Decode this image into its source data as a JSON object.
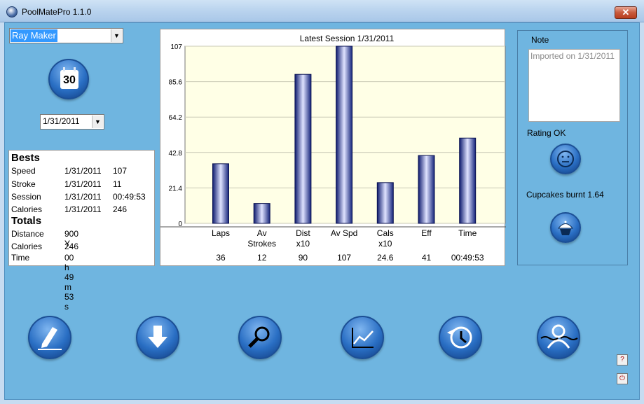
{
  "window": {
    "title": "PoolMatePro 1.1.0",
    "close_label": "✕"
  },
  "user": {
    "selected": "Ray Maker"
  },
  "calendar": {
    "day": "30"
  },
  "session_date": {
    "selected": "1/31/2011"
  },
  "bests": {
    "heading": "Bests",
    "rows": [
      {
        "label": "Speed",
        "date": "1/31/2011",
        "value": "107"
      },
      {
        "label": "Stroke",
        "date": "1/31/2011",
        "value": "11"
      },
      {
        "label": "Session",
        "date": "1/31/2011",
        "value": "00:49:53"
      },
      {
        "label": "Calories",
        "date": "1/31/2011",
        "value": "246"
      }
    ]
  },
  "totals": {
    "heading": "Totals",
    "rows": [
      {
        "label": "Distance",
        "value": "900 Y"
      },
      {
        "label": "Calories",
        "value": "246"
      },
      {
        "label": "Time",
        "value": "00 h 49 m 53 s"
      }
    ]
  },
  "chart_data": {
    "type": "bar",
    "title": "Latest Session 1/31/2011",
    "categories": [
      "Laps",
      "Av\nStrokes",
      "Dist\nx10",
      "Av Spd",
      "Cals\nx10",
      "Eff",
      "Time"
    ],
    "values": [
      36,
      12,
      90,
      107,
      24.6,
      41,
      51.5
    ],
    "value_labels": [
      "36",
      "12",
      "90",
      "107",
      "24.6",
      "41",
      "00:49:53"
    ],
    "yticks": [
      "0",
      "21.4",
      "42.8",
      "64.2",
      "85.6",
      "107"
    ],
    "ylim": [
      0,
      107
    ],
    "grid": true,
    "bar_color": "#2a3a9c"
  },
  "note": {
    "title": "Note",
    "text": "Imported on 1/31/2011"
  },
  "rating": {
    "text": "Rating OK"
  },
  "cupcakes": {
    "text": "Cupcakes burnt 1.64"
  },
  "toolbar": {
    "items": [
      "edit-icon",
      "download-icon",
      "search-icon",
      "chart-icon",
      "history-icon",
      "swimmer-icon"
    ]
  },
  "side_buttons": {
    "help": "?",
    "power": "⏻"
  }
}
